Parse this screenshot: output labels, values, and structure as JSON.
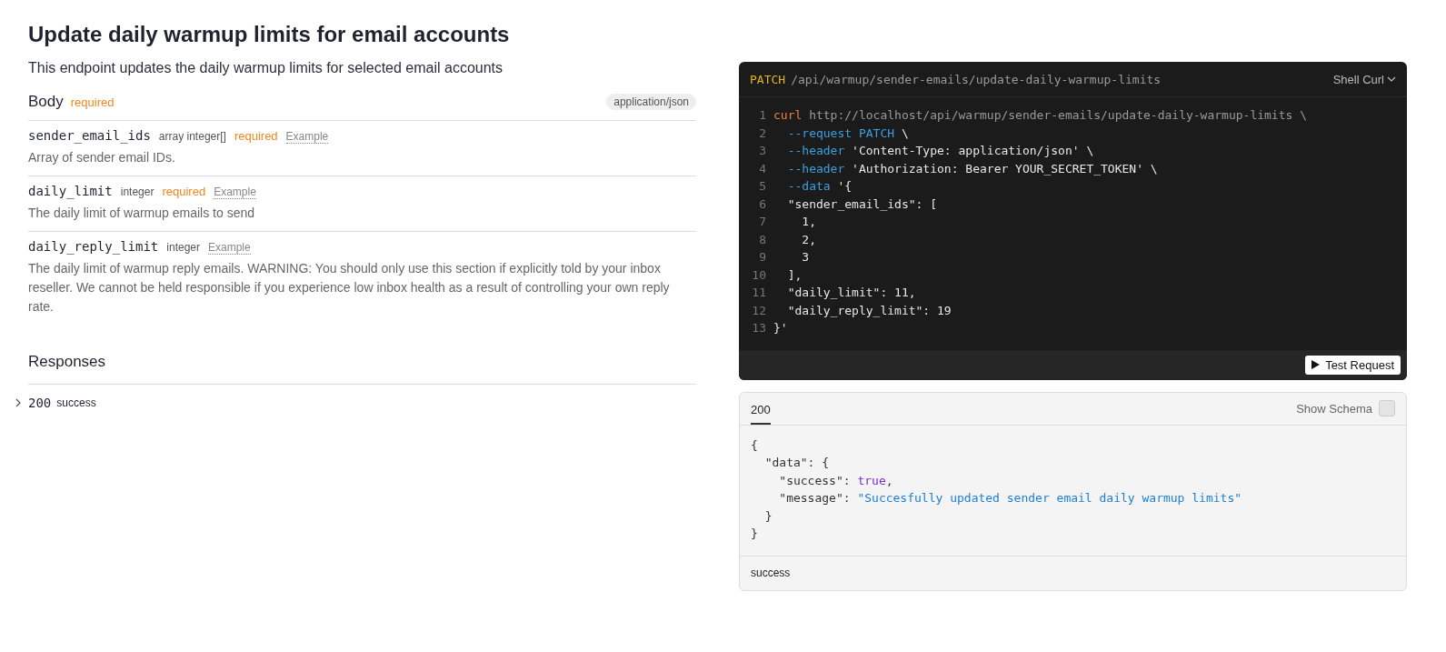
{
  "title": "Update daily warmup limits for email accounts",
  "description": "This endpoint updates the daily warmup limits for selected email accounts",
  "body": {
    "label": "Body",
    "required": "required",
    "content_type": "application/json",
    "params": [
      {
        "name": "sender_email_ids",
        "type": "array integer[]",
        "required": "required",
        "example": "Example",
        "description": "Array of sender email IDs."
      },
      {
        "name": "daily_limit",
        "type": "integer",
        "required": "required",
        "example": "Example",
        "description": "The daily limit of warmup emails to send"
      },
      {
        "name": "daily_reply_limit",
        "type": "integer",
        "example": "Example",
        "description": "The daily limit of warmup reply emails. WARNING: You should only use this section if explicitly told by your inbox reseller. We cannot be held responsible if you experience low inbox health as a result of controlling your own reply rate."
      }
    ]
  },
  "responses": {
    "label": "Responses",
    "items": [
      {
        "code": "200",
        "text": "success",
        "expanded": false
      }
    ]
  },
  "request": {
    "method": "PATCH",
    "path": "/api/warmup/sender-emails/update-daily-warmup-limits",
    "language": "Shell Curl",
    "lines": [
      {
        "number": "1",
        "tokens": [
          {
            "kind": "command",
            "text": "curl"
          },
          {
            "kind": "url",
            "text": " http://localhost/api/warmup/sender-emails/update-daily-warmup-limits \\"
          }
        ]
      },
      {
        "number": "2",
        "tokens": [
          {
            "kind": "flag",
            "text": "  --request PATCH"
          },
          {
            "kind": "plain",
            "text": " \\"
          }
        ]
      },
      {
        "number": "3",
        "tokens": [
          {
            "kind": "flag",
            "text": "  --header"
          },
          {
            "kind": "plain",
            "text": " 'Content-Type: application/json' \\"
          }
        ]
      },
      {
        "number": "4",
        "tokens": [
          {
            "kind": "flag",
            "text": "  --header"
          },
          {
            "kind": "plain",
            "text": " 'Authorization: Bearer YOUR_SECRET_TOKEN' \\"
          }
        ]
      },
      {
        "number": "5",
        "tokens": [
          {
            "kind": "flag",
            "text": "  --data"
          },
          {
            "kind": "plain",
            "text": " '{"
          }
        ]
      },
      {
        "number": "6",
        "tokens": [
          {
            "kind": "plain",
            "text": "  \"sender_email_ids\": ["
          }
        ]
      },
      {
        "number": "7",
        "tokens": [
          {
            "kind": "plain",
            "text": "    1,"
          }
        ]
      },
      {
        "number": "8",
        "tokens": [
          {
            "kind": "plain",
            "text": "    2,"
          }
        ]
      },
      {
        "number": "9",
        "tokens": [
          {
            "kind": "plain",
            "text": "    3"
          }
        ]
      },
      {
        "number": "10",
        "tokens": [
          {
            "kind": "plain",
            "text": "  ],"
          }
        ]
      },
      {
        "number": "11",
        "tokens": [
          {
            "kind": "plain",
            "text": "  \"daily_limit\": 11,"
          }
        ]
      },
      {
        "number": "12",
        "tokens": [
          {
            "kind": "plain",
            "text": "  \"daily_reply_limit\": 19"
          }
        ]
      },
      {
        "number": "13",
        "tokens": [
          {
            "kind": "plain",
            "text": "}'"
          }
        ]
      }
    ],
    "button": "Test Request"
  },
  "response_example": {
    "tabs": [
      {
        "label": "200",
        "selected": true
      }
    ],
    "show_schema": {
      "label": "Show Schema",
      "checked": false
    },
    "lines": [
      {
        "tokens": [
          {
            "kind": "plain",
            "text": "{"
          }
        ]
      },
      {
        "tokens": [
          {
            "kind": "plain",
            "text": "  \"data\": {"
          }
        ]
      },
      {
        "tokens": [
          {
            "kind": "plain",
            "text": "    \"success\": "
          },
          {
            "kind": "boolean",
            "text": "true"
          },
          {
            "kind": "plain",
            "text": ","
          }
        ]
      },
      {
        "tokens": [
          {
            "kind": "plain",
            "text": "    \"message\": "
          },
          {
            "kind": "string",
            "text": "\"Succesfully updated sender email daily warmup limits\""
          }
        ]
      },
      {
        "tokens": [
          {
            "kind": "plain",
            "text": "  }"
          }
        ]
      },
      {
        "tokens": [
          {
            "kind": "plain",
            "text": "}"
          }
        ]
      }
    ],
    "footer": "success"
  }
}
